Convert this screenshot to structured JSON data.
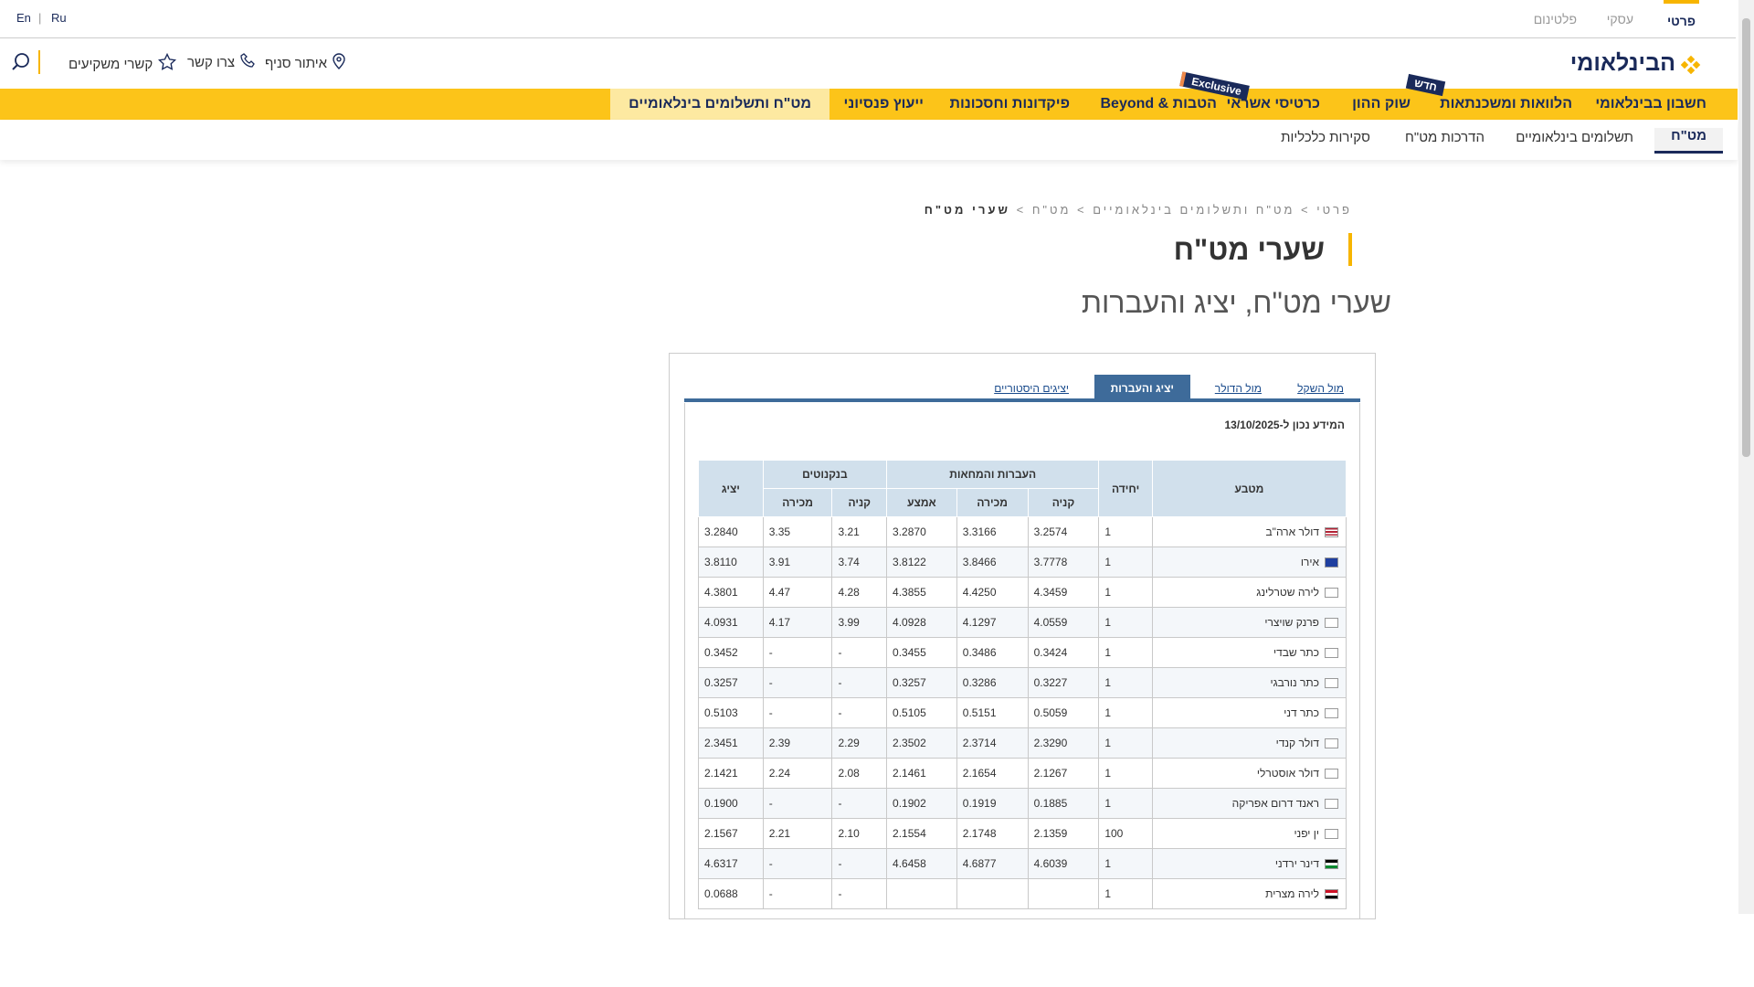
{
  "topbar": {
    "segments": [
      "פרטי",
      "עסקי",
      "פלטינום"
    ],
    "langs": [
      "Ru",
      "En"
    ],
    "lang_sep": "|"
  },
  "header": {
    "logo": "הבינלאומי",
    "links": [
      "איתור סניף",
      "צרו קשר",
      "קשרי משקיעים"
    ]
  },
  "mainnav": [
    "חשבון בבינלאומי",
    "הלוואות ומשכנתאות",
    "שוק ההון",
    "כרטיסי אשראי",
    "הטבות & Beyond",
    "פיקדונות וחסכונות",
    "ייעוץ פנסיוני",
    "מט\"ח ותשלומים בינלאומיים"
  ],
  "badges": {
    "new": "חדש",
    "exclusive": "Exclusive"
  },
  "subnav": [
    "מט\"ח",
    "תשלומים בינלאומיים",
    "הדרכות מט\"ח",
    "סקירות כלכליות"
  ],
  "breadcrumb": {
    "items": [
      "פרטי",
      "מט\"ח ותשלומים בינלאומיים",
      "מט\"ח"
    ],
    "current": "שערי מט\"ח",
    "sep": ">"
  },
  "page": {
    "title": "שערי מט\"ח",
    "subtitle": "שערי מט\"ח, יציג והעברות"
  },
  "tabs": [
    "מול השקל",
    "מול הדולר",
    "יציג והעברות",
    "יציגים היסטוריים"
  ],
  "date_text": "המידע נכון ל-13/10/2025",
  "table": {
    "headers": {
      "currency": "מטבע",
      "unit": "יחידה",
      "transfers": "העברות והמחאות",
      "banknotes": "בנקנוטים",
      "official": "יציג",
      "buy": "קניה",
      "sell": "מכירה",
      "mid": "אמצע"
    },
    "rows": [
      {
        "name": "דולר ארה\"ב",
        "unit": "1",
        "t_buy": "3.2574",
        "t_sell": "3.3166",
        "t_mid": "3.2870",
        "b_buy": "3.21",
        "b_sell": "3.35",
        "official": "3.2840",
        "flag": "us"
      },
      {
        "name": "אירו",
        "unit": "1",
        "t_buy": "3.7778",
        "t_sell": "3.8466",
        "t_mid": "3.8122",
        "b_buy": "3.74",
        "b_sell": "3.91",
        "official": "3.8110",
        "flag": "eu"
      },
      {
        "name": "לירה שטרלינג",
        "unit": "1",
        "t_buy": "4.3459",
        "t_sell": "4.4250",
        "t_mid": "4.3855",
        "b_buy": "4.28",
        "b_sell": "4.47",
        "official": "4.3801",
        "flag": "broken"
      },
      {
        "name": "פרנק שויצרי",
        "unit": "1",
        "t_buy": "4.0559",
        "t_sell": "4.1297",
        "t_mid": "4.0928",
        "b_buy": "3.99",
        "b_sell": "4.17",
        "official": "4.0931",
        "flag": "broken"
      },
      {
        "name": "כתר שבדי",
        "unit": "1",
        "t_buy": "0.3424",
        "t_sell": "0.3486",
        "t_mid": "0.3455",
        "b_buy": "-",
        "b_sell": "-",
        "official": "0.3452",
        "flag": "broken"
      },
      {
        "name": "כתר נורבגי",
        "unit": "1",
        "t_buy": "0.3227",
        "t_sell": "0.3286",
        "t_mid": "0.3257",
        "b_buy": "-",
        "b_sell": "-",
        "official": "0.3257",
        "flag": "broken"
      },
      {
        "name": "כתר דני",
        "unit": "1",
        "t_buy": "0.5059",
        "t_sell": "0.5151",
        "t_mid": "0.5105",
        "b_buy": "-",
        "b_sell": "-",
        "official": "0.5103",
        "flag": "broken"
      },
      {
        "name": "דולר קנדי",
        "unit": "1",
        "t_buy": "2.3290",
        "t_sell": "2.3714",
        "t_mid": "2.3502",
        "b_buy": "2.29",
        "b_sell": "2.39",
        "official": "2.3451",
        "flag": "broken"
      },
      {
        "name": "דולר אוסטרלי",
        "unit": "1",
        "t_buy": "2.1267",
        "t_sell": "2.1654",
        "t_mid": "2.1461",
        "b_buy": "2.08",
        "b_sell": "2.24",
        "official": "2.1421",
        "flag": "broken"
      },
      {
        "name": "ראנד דרום אפריקה",
        "unit": "1",
        "t_buy": "0.1885",
        "t_sell": "0.1919",
        "t_mid": "0.1902",
        "b_buy": "-",
        "b_sell": "-",
        "official": "0.1900",
        "flag": "broken"
      },
      {
        "name": "ין יפני",
        "unit": "100",
        "t_buy": "2.1359",
        "t_sell": "2.1748",
        "t_mid": "2.1554",
        "b_buy": "2.10",
        "b_sell": "2.21",
        "official": "2.1567",
        "flag": "broken"
      },
      {
        "name": "דינר ירדני",
        "unit": "1",
        "t_buy": "4.6039",
        "t_sell": "4.6877",
        "t_mid": "4.6458",
        "b_buy": "-",
        "b_sell": "-",
        "official": "4.6317",
        "flag": "jo"
      },
      {
        "name": "לירה מצרית",
        "unit": "1",
        "t_buy": "",
        "t_sell": "",
        "t_mid": "",
        "b_buy": "-",
        "b_sell": "-",
        "official": "0.0688",
        "flag": "eg"
      }
    ]
  },
  "colors": {
    "accent": "#fcc419",
    "brand": "#1a2a5a",
    "tab_blue": "#3e6b9a",
    "header_cell": "#d1e0ec"
  }
}
